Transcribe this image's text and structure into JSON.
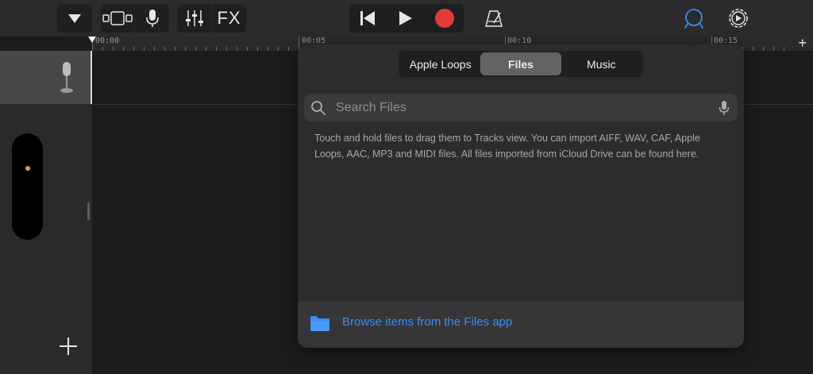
{
  "ruler": {
    "labels": [
      "00:00",
      "00:05",
      "00:10",
      "00:15"
    ]
  },
  "browser": {
    "tabs": [
      {
        "label": "Apple Loops",
        "active": false
      },
      {
        "label": "Files",
        "active": true
      },
      {
        "label": "Music",
        "active": false
      }
    ],
    "search": {
      "placeholder": "Search Files",
      "value": ""
    },
    "info": "Touch and hold files to drag them to Tracks view. You can import AIFF, WAV, CAF, Apple Loops, AAC, MP3 and MIDI files. All files imported from iCloud Drive can be found here.",
    "browse_label": "Browse items from the Files app"
  },
  "toolbar": {
    "fx_label": "FX"
  },
  "colors": {
    "record": "#e33b36",
    "accent_blue": "#3d8cf2",
    "volume_dot": "#f29a38"
  },
  "icons": {
    "track_type": "microphone-icon",
    "record": "record-icon"
  }
}
